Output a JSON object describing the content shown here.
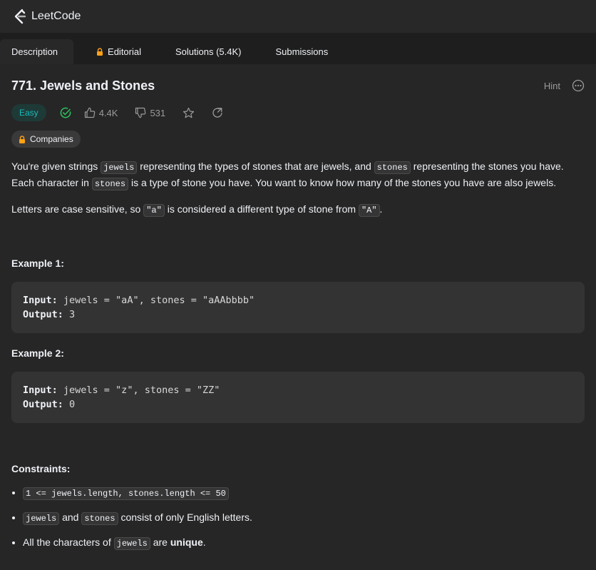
{
  "app": {
    "logo_text": "LeetCode",
    "accent": "#ffa116"
  },
  "tabs": [
    {
      "label": "Description",
      "active": true
    },
    {
      "label": "Editorial",
      "locked": true
    },
    {
      "label": "Solutions (5.4K)"
    },
    {
      "label": "Submissions"
    }
  ],
  "problem": {
    "title": "771. Jewels and Stones",
    "hint_label": "Hint",
    "difficulty": "Easy",
    "likes": "4.4K",
    "dislikes": "531",
    "companies_label": "Companies"
  },
  "description": {
    "p1_a": "You're given strings ",
    "p1_code1": "jewels",
    "p1_b": " representing the types of stones that are jewels, and ",
    "p1_code2": "stones",
    "p1_c": " representing the stones you have. Each character in ",
    "p1_code3": "stones",
    "p1_d": " is a type of stone you have. You want to know how many of the stones you have are also jewels.",
    "p2_a": "Letters are case sensitive, so ",
    "p2_code1": "\"a\"",
    "p2_b": " is considered a different type of stone from ",
    "p2_code2": "\"A\"",
    "p2_c": "."
  },
  "examples": [
    {
      "title": "Example 1:",
      "input_label": "Input:",
      "input": " jewels = \"aA\", stones = \"aAAbbbb\"",
      "output_label": "Output:",
      "output": " 3"
    },
    {
      "title": "Example 2:",
      "input_label": "Input:",
      "input": " jewels = \"z\", stones = \"ZZ\"",
      "output_label": "Output:",
      "output": " 0"
    }
  ],
  "constraints": {
    "title": "Constraints:",
    "c1_code": "1 <= jewels.length, stones.length <= 50",
    "c2_code1": "jewels",
    "c2_mid": " and ",
    "c2_code2": "stones",
    "c2_end": " consist of only English letters.",
    "c3_a": "All the characters of ",
    "c3_code": "jewels",
    "c3_b": " are ",
    "c3_strong": "unique",
    "c3_c": "."
  }
}
